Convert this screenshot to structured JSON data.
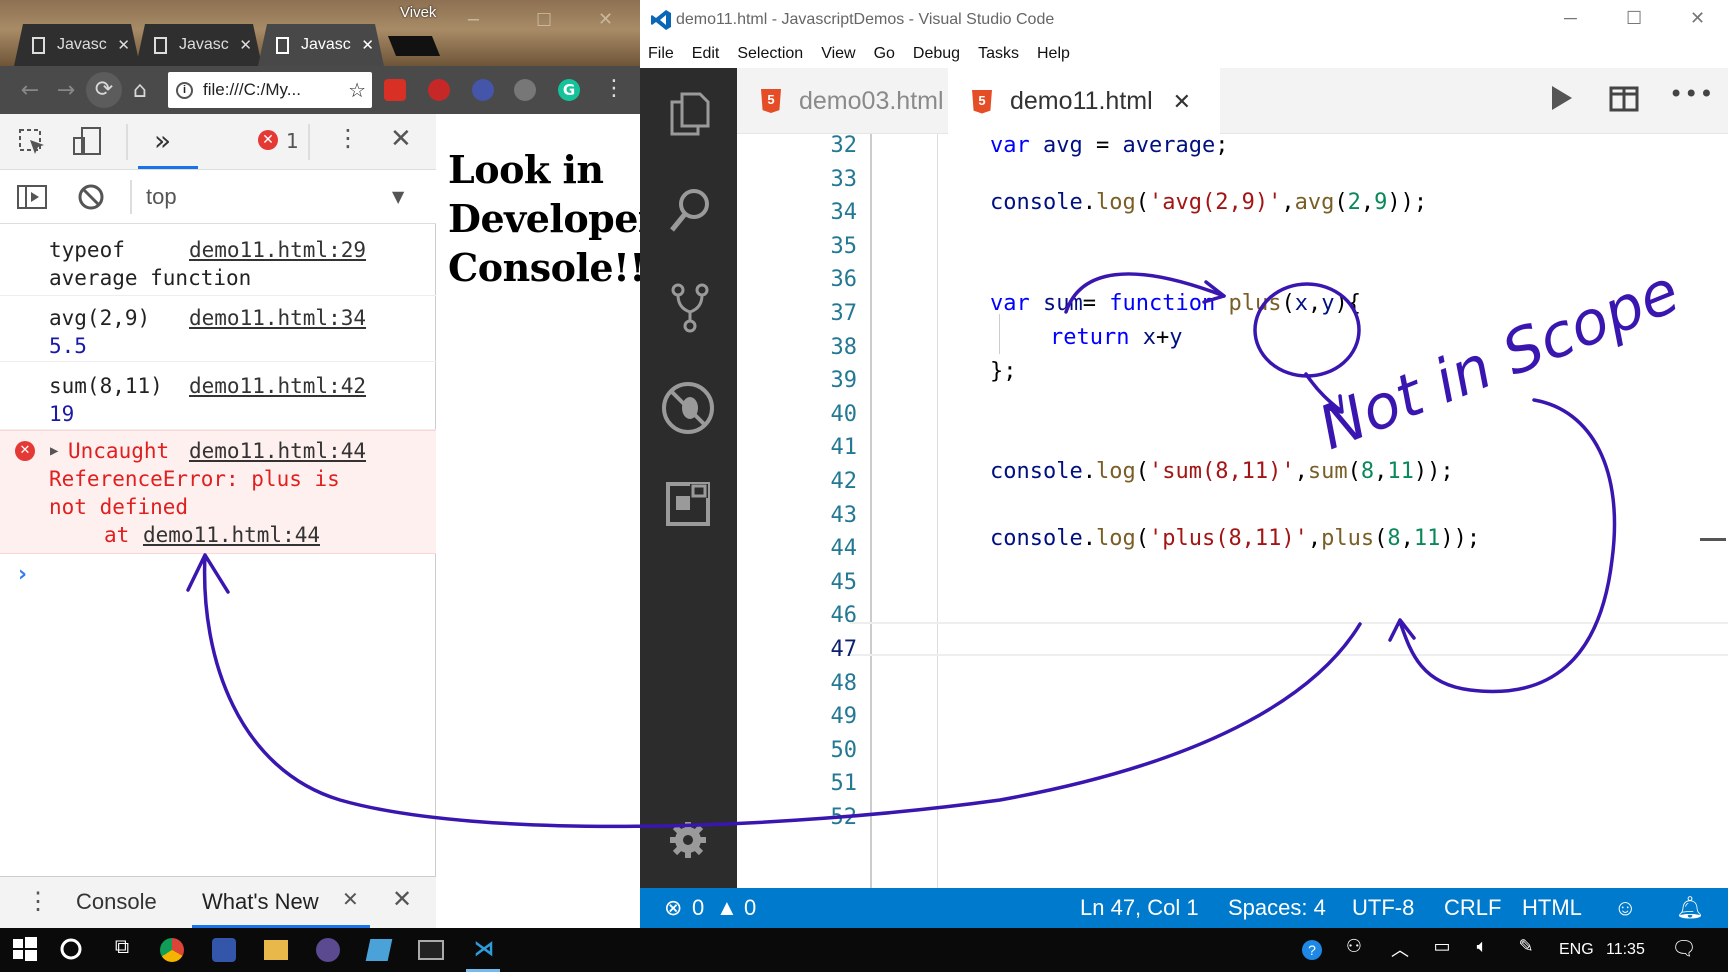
{
  "chrome": {
    "user": "Vivek",
    "tabs": [
      {
        "label": "Javasc"
      },
      {
        "label": "Javasc"
      },
      {
        "label": "Javasc"
      }
    ],
    "address": "file:///C:/My...",
    "devtools": {
      "error_count": "1",
      "context": "top",
      "messages": [
        {
          "line1": "typeof",
          "line2": "average function",
          "source": "demo11.html:29"
        },
        {
          "line1": "avg(2,9)",
          "line2": "5.5",
          "source": "demo11.html:34"
        },
        {
          "line1": "sum(8,11)",
          "line2": "19",
          "source": "demo11.html:42"
        }
      ],
      "error": {
        "prefix": "Uncaught",
        "source": "demo11.html:44",
        "line2": "ReferenceError: plus is",
        "line3": "not defined",
        "at_label": "at",
        "at_link": "demo11.html:44"
      },
      "drawer_tabs": {
        "console": "Console",
        "whats_new": "What's New"
      }
    },
    "page_heading": "Look in Developer Console!!!"
  },
  "vscode": {
    "title": "demo11.html - JavascriptDemos - Visual Studio Code",
    "menu": [
      "File",
      "Edit",
      "Selection",
      "View",
      "Go",
      "Debug",
      "Tasks",
      "Help"
    ],
    "tabs": [
      {
        "label": "demo03.html",
        "active": false
      },
      {
        "label": "demo11.html",
        "active": true
      }
    ],
    "line_numbers": [
      "32",
      "33",
      "34",
      "35",
      "36",
      "37",
      "38",
      "39",
      "40",
      "41",
      "42",
      "43",
      "44",
      "45",
      "46",
      "47",
      "48",
      "49",
      "50",
      "51",
      "52"
    ],
    "status": {
      "errors": "0",
      "warnings": "0",
      "position": "Ln 47, Col 1",
      "spaces": "Spaces: 4",
      "encoding": "UTF-8",
      "eol": "CRLF",
      "language": "HTML"
    }
  },
  "annotation": {
    "text": "Not in Scope",
    "color": "#3a16b0"
  },
  "taskbar": {
    "language": "ENG",
    "time": "11:35"
  }
}
